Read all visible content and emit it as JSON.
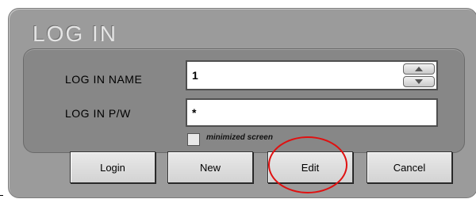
{
  "dialog": {
    "title": "LOG IN"
  },
  "form": {
    "name_label": "LOG IN NAME",
    "name_value": "1",
    "password_label": "LOG IN P/W",
    "password_value": "*",
    "checkbox_label": "minimized screen",
    "checkbox_checked": false
  },
  "buttons": {
    "login": "Login",
    "new": "New",
    "edit": "Edit",
    "cancel": "Cancel"
  },
  "annotation": {
    "color": "#e01010",
    "target": "edit-button"
  },
  "colors": {
    "dialog_bg": "#9b9b9b",
    "panel_bg": "#878787",
    "title_color": "#e4e4e4"
  },
  "icons": {
    "spinner_up": "triangle-up-icon",
    "spinner_down": "triangle-down-icon"
  }
}
